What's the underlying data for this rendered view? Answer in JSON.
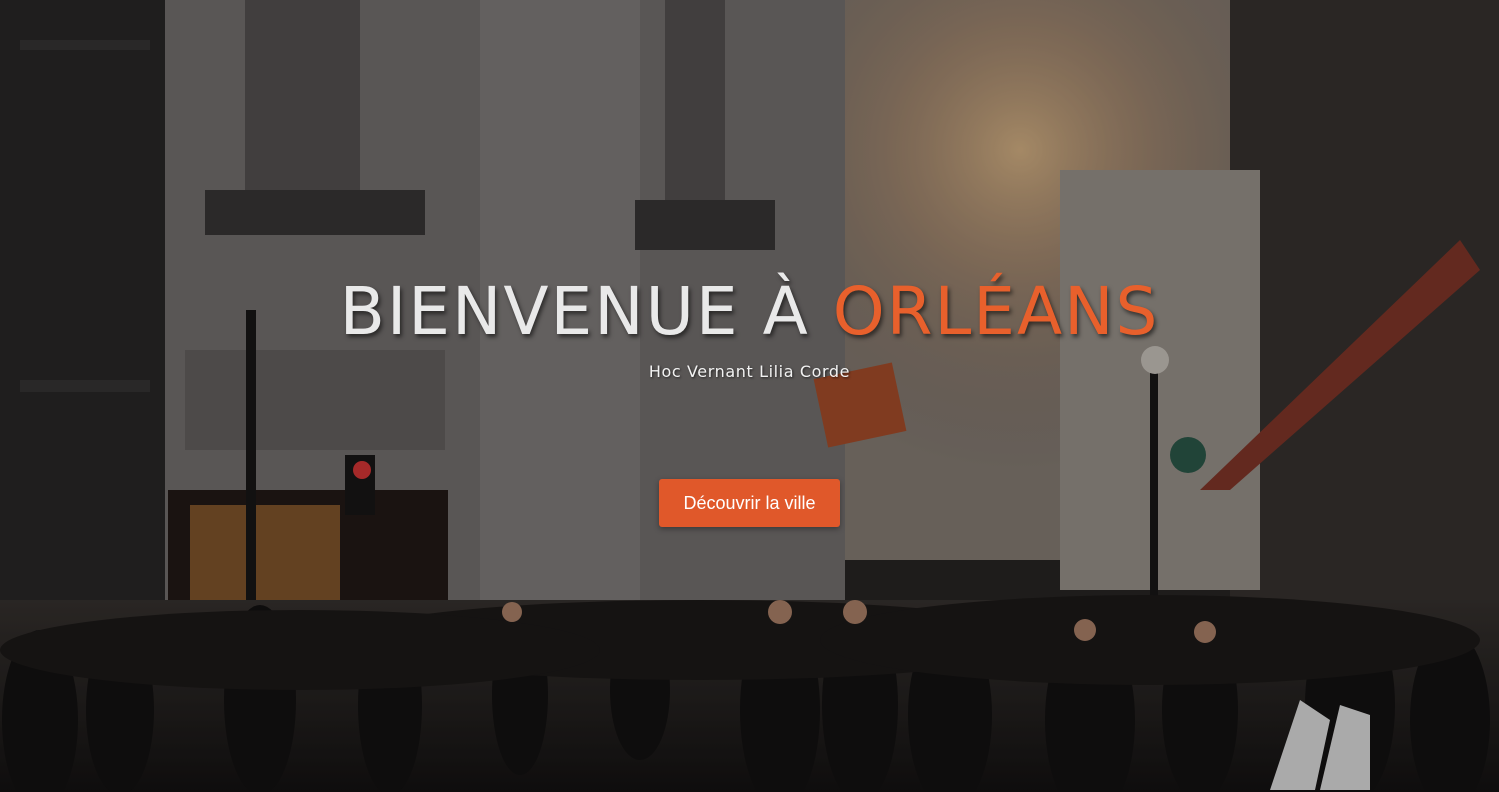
{
  "hero": {
    "title_main": "BIENVENUE À ",
    "title_accent": "ORLÉANS",
    "subtitle": "Hoc Vernant Lilia Corde",
    "cta_label": "Découvrir la ville",
    "accent_color": "#e8602c",
    "button_color": "#e0582a",
    "background_image": "crowded-city-street-photo"
  }
}
